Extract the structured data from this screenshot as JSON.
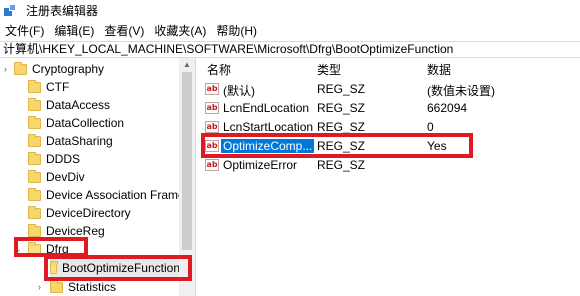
{
  "window": {
    "title": "注册表编辑器",
    "icon": "registry-editor-icon"
  },
  "menu": [
    "文件(F)",
    "编辑(E)",
    "查看(V)",
    "收藏夹(A)",
    "帮助(H)"
  ],
  "address": "计算机\\HKEY_LOCAL_MACHINE\\SOFTWARE\\Microsoft\\Dfrg\\BootOptimizeFunction",
  "tree": {
    "items": [
      {
        "label": "Cryptography",
        "expanded": false
      },
      {
        "label": "CTF",
        "expanded": false
      },
      {
        "label": "DataAccess",
        "expanded": false
      },
      {
        "label": "DataCollection",
        "expanded": false
      },
      {
        "label": "DataSharing",
        "expanded": false
      },
      {
        "label": "DDDS",
        "expanded": false
      },
      {
        "label": "DevDiv",
        "expanded": false
      },
      {
        "label": "Device Association Frame",
        "expanded": false
      },
      {
        "label": "DeviceDirectory",
        "expanded": false
      },
      {
        "label": "DeviceReg",
        "expanded": false
      },
      {
        "label": "Dfrg",
        "expanded": true
      },
      {
        "label": "BootOptimizeFunction",
        "selected": true
      },
      {
        "label": "Statistics",
        "expanded": false
      }
    ]
  },
  "values": {
    "columns": {
      "name": "名称",
      "type": "类型",
      "data": "数据"
    },
    "rows": [
      {
        "name": "(默认)",
        "type": "REG_SZ",
        "data": "(数值未设置)"
      },
      {
        "name": "LcnEndLocation",
        "type": "REG_SZ",
        "data": "662094"
      },
      {
        "name": "LcnStartLocation",
        "type": "REG_SZ",
        "data": "0"
      },
      {
        "name": "OptimizeComp...",
        "type": "REG_SZ",
        "data": "Yes",
        "selected": true
      },
      {
        "name": "OptimizeError",
        "type": "REG_SZ",
        "data": ""
      }
    ]
  },
  "colors": {
    "highlight": "#e01a22",
    "selection": "#0078d7",
    "folder": "#f7d66a"
  }
}
